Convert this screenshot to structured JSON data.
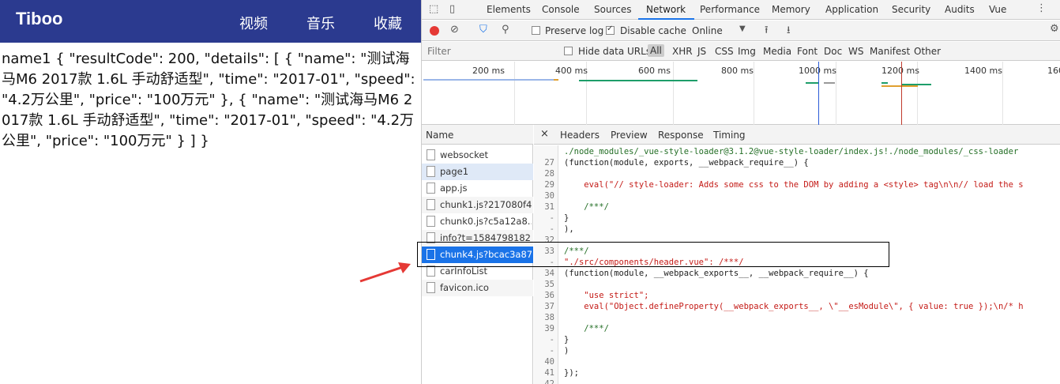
{
  "app": {
    "brand": "Tiboo",
    "nav": [
      "视频",
      "音乐",
      "收藏"
    ],
    "body_text": "name1 { \"resultCode\": 200, \"details\": [ { \"name\": \"测试海马M6 2017款 1.6L 手动舒适型\", \"time\": \"2017-01\", \"speed\": \"4.2万公里\", \"price\": \"100万元\" }, { \"name\": \"测试海马M6 2017款 1.6L 手动舒适型\", \"time\": \"2017-01\", \"speed\": \"4.2万公里\", \"price\": \"100万元\" } ] }"
  },
  "devtools": {
    "tabs": [
      "Elements",
      "Console",
      "Sources",
      "Network",
      "Performance",
      "Memory",
      "Application",
      "Security",
      "Audits",
      "Vue"
    ],
    "active_tab": "Network",
    "toolbar": {
      "preserve_log": "Preserve log",
      "disable_cache": "Disable cache",
      "throttle": "Online"
    },
    "filter": {
      "placeholder": "Filter",
      "hide_data_urls": "Hide data URLs",
      "types": [
        "All",
        "XHR",
        "JS",
        "CSS",
        "Img",
        "Media",
        "Font",
        "Doc",
        "WS",
        "Manifest",
        "Other"
      ]
    },
    "timeline_ticks": [
      "200 ms",
      "400 ms",
      "600 ms",
      "800 ms",
      "1000 ms",
      "1200 ms",
      "1400 ms",
      "160"
    ],
    "name_header": "Name",
    "requests": [
      "websocket",
      "page1",
      "app.js",
      "chunk1.js?217080f4...",
      "chunk0.js?c5a12a8...",
      "info?t=1584798182...",
      "chunk4.js?bcac3a87...",
      "carInfoList",
      "favicon.ico"
    ],
    "detail_tabs": [
      "Headers",
      "Preview",
      "Response",
      "Timing"
    ],
    "code_lines": [
      {
        "n": "",
        "t": "./node_modules/_vue-style-loader@3.1.2@vue-style-loader/index.js!./node_modules/_css-loader"
      },
      {
        "n": "27",
        "t": "(function(module, exports, __webpack_require__) {"
      },
      {
        "n": "28",
        "t": ""
      },
      {
        "n": "29",
        "t": "    eval(\"// style-loader: Adds some css to the DOM by adding a <style> tag\\n\\n// load the s"
      },
      {
        "n": "30",
        "t": ""
      },
      {
        "n": "31",
        "t": "    /***/"
      },
      {
        "n": "-",
        "t": "}"
      },
      {
        "n": "-",
        "t": "),"
      },
      {
        "n": "32",
        "t": ""
      },
      {
        "n": "33",
        "t": "/***/"
      },
      {
        "n": "-",
        "t": "\"./src/components/header.vue\": /***/"
      },
      {
        "n": "34",
        "t": "(function(module, __webpack_exports__, __webpack_require__) {"
      },
      {
        "n": "35",
        "t": ""
      },
      {
        "n": "36",
        "t": "    \"use strict\";"
      },
      {
        "n": "37",
        "t": "    eval(\"Object.defineProperty(__webpack_exports__, \\\"__esModule\\\", { value: true });\\n/* h"
      },
      {
        "n": "38",
        "t": ""
      },
      {
        "n": "39",
        "t": "    /***/"
      },
      {
        "n": "-",
        "t": "}"
      },
      {
        "n": "-",
        "t": ")"
      },
      {
        "n": "40",
        "t": ""
      },
      {
        "n": "41",
        "t": "});"
      },
      {
        "n": "42",
        "t": ""
      }
    ]
  },
  "colors": {
    "header_bg": "#2b3a8f",
    "selected": "#1a73e8",
    "arrow": "#e53935"
  }
}
